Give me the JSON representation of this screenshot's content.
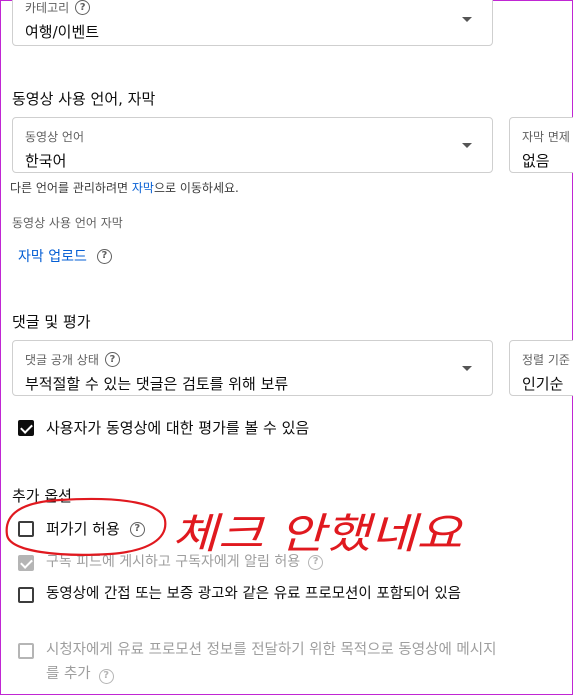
{
  "category": {
    "label": "카테고리",
    "value": "여행/이벤트"
  },
  "language_section": {
    "heading": "동영상 사용 언어, 자막",
    "video_language": {
      "label": "동영상 언어",
      "value": "한국어"
    },
    "caption_cert": {
      "label": "자막 면제",
      "value": "없음"
    },
    "manage_text_before": "다른 언어를 관리하려면 ",
    "manage_link": "자막",
    "manage_text_after": "으로 이동하세요.",
    "subtitle_label": "동영상 사용 언어 자막",
    "upload_link": "자막 업로드"
  },
  "comments_section": {
    "heading": "댓글 및 평가",
    "visibility": {
      "label": "댓글 공개 상태",
      "value": "부적절할 수 있는 댓글은 검토를 위해 보류"
    },
    "sort": {
      "label": "정렬 기준",
      "value": "인기순"
    },
    "show_ratings": "사용자가 동영상에 대한 평가를 볼 수 있음"
  },
  "additional": {
    "heading": "추가 옵션",
    "allow_embed": "퍼가기 허용",
    "notify_subs": "구독 피드에 게시하고 구독자에게 알림 허용",
    "paid_promo": "동영상에 간접 또는 보증 광고와 같은 유료 프로모션이 포함되어 있음",
    "paid_promo_message": "시청자에게 유료 프로모션 정보를 전달하기 위한 목적으로 동영상에 메시지를 추가"
  },
  "annotation": {
    "text": "체크 안했네요",
    "color": "#e0191f"
  },
  "colors": {
    "link": "#065fd4",
    "frame": "#c026d3"
  }
}
